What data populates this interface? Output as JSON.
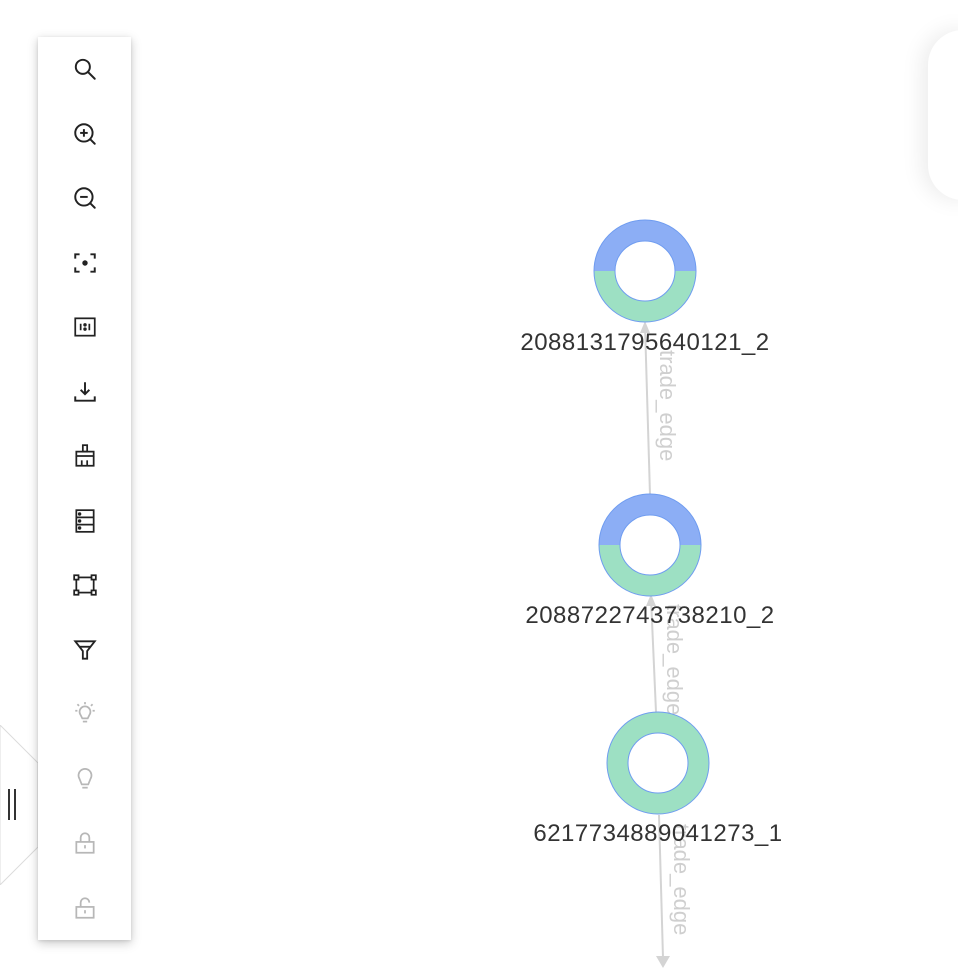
{
  "toolbar": {
    "tools": [
      {
        "name": "search",
        "icon": "search-icon"
      },
      {
        "name": "zoom-in",
        "icon": "zoom-in-icon"
      },
      {
        "name": "zoom-out",
        "icon": "zoom-out-icon"
      },
      {
        "name": "focus",
        "icon": "focus-icon"
      },
      {
        "name": "actual-size",
        "icon": "actual-size-icon"
      },
      {
        "name": "download",
        "icon": "download-icon"
      },
      {
        "name": "clear",
        "icon": "broom-icon"
      },
      {
        "name": "list",
        "icon": "list-icon"
      },
      {
        "name": "select-box",
        "icon": "select-box-icon"
      },
      {
        "name": "filter",
        "icon": "filter-icon"
      },
      {
        "name": "highlight-on",
        "icon": "bulb-on-icon",
        "disabled": true
      },
      {
        "name": "highlight-off",
        "icon": "bulb-off-icon",
        "disabled": true
      },
      {
        "name": "lock",
        "icon": "lock-icon",
        "disabled": true
      },
      {
        "name": "unlock",
        "icon": "unlock-icon",
        "disabled": true
      }
    ]
  },
  "collapse_handle": {
    "icon": "collapse-handle-icon"
  },
  "graph": {
    "nodes": [
      {
        "id": "node-1",
        "label": "2088131795640121_2",
        "ring": [
          "blue",
          "green"
        ]
      },
      {
        "id": "node-2",
        "label": "2088722743738210_2",
        "ring": [
          "blue",
          "green"
        ]
      },
      {
        "id": "node-3",
        "label": "6217734889041273_1",
        "ring": [
          "green"
        ]
      }
    ],
    "edges": [
      {
        "label": "trade_edge"
      },
      {
        "label": "trade_edge"
      },
      {
        "label": "trade_edge"
      }
    ],
    "colors": {
      "ring_blue": "#8caef5",
      "ring_green": "#9de0c3",
      "ring_outline": "#6f9cf0",
      "edge": "#d4d4d4",
      "edge_label": "#cfcfcf",
      "node_label": "#333333"
    }
  }
}
